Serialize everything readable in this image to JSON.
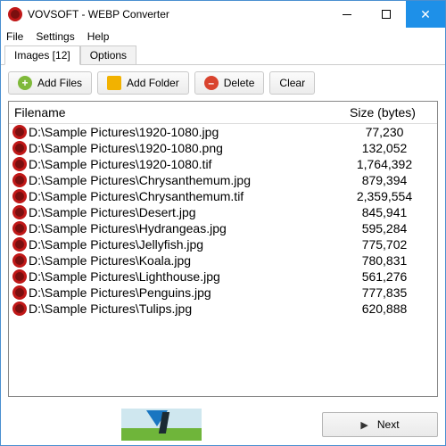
{
  "title": "VOVSOFT - WEBP Converter",
  "menu": {
    "file": "File",
    "settings": "Settings",
    "help": "Help"
  },
  "tabs": {
    "images": "Images [12]",
    "options": "Options"
  },
  "toolbar": {
    "addFiles": "Add Files",
    "addFolder": "Add Folder",
    "delete": "Delete",
    "clear": "Clear"
  },
  "columns": {
    "filename": "Filename",
    "size": "Size (bytes)"
  },
  "files": [
    {
      "name": "D:\\Sample Pictures\\1920-1080.jpg",
      "size": "77,230"
    },
    {
      "name": "D:\\Sample Pictures\\1920-1080.png",
      "size": "132,052"
    },
    {
      "name": "D:\\Sample Pictures\\1920-1080.tif",
      "size": "1,764,392"
    },
    {
      "name": "D:\\Sample Pictures\\Chrysanthemum.jpg",
      "size": "879,394"
    },
    {
      "name": "D:\\Sample Pictures\\Chrysanthemum.tif",
      "size": "2,359,554"
    },
    {
      "name": "D:\\Sample Pictures\\Desert.jpg",
      "size": "845,941"
    },
    {
      "name": "D:\\Sample Pictures\\Hydrangeas.jpg",
      "size": "595,284"
    },
    {
      "name": "D:\\Sample Pictures\\Jellyfish.jpg",
      "size": "775,702"
    },
    {
      "name": "D:\\Sample Pictures\\Koala.jpg",
      "size": "780,831"
    },
    {
      "name": "D:\\Sample Pictures\\Lighthouse.jpg",
      "size": "561,276"
    },
    {
      "name": "D:\\Sample Pictures\\Penguins.jpg",
      "size": "777,835"
    },
    {
      "name": "D:\\Sample Pictures\\Tulips.jpg",
      "size": "620,888"
    }
  ],
  "footer": {
    "next": "Next"
  }
}
